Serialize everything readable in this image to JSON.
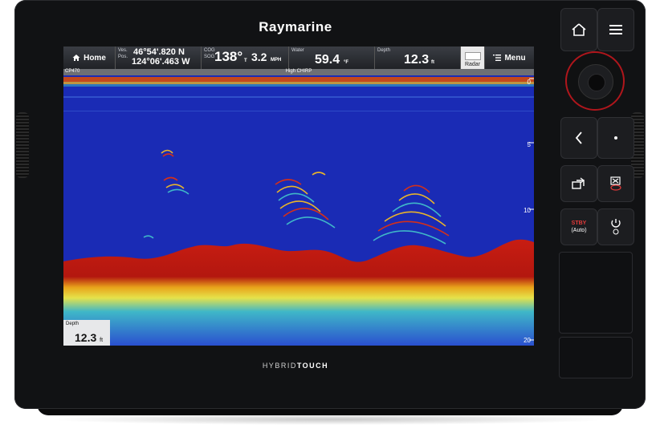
{
  "device": {
    "brand": "Raymarine",
    "footer_prefix": "HYBRID",
    "footer_suffix": "TOUCH"
  },
  "databar": {
    "home_label": "Home",
    "vessel_label_1": "Ves.",
    "vessel_label_2": "Pos.",
    "lat": "46°54'.820 N",
    "lon": "124°06'.463 W",
    "cog_label": "COG",
    "sog_label": "SOG",
    "cog_value": "138°",
    "cog_unit": "T",
    "sog_value": "3.2",
    "sog_unit": "MPH",
    "water_label": "Water",
    "water_value": "59.4",
    "water_unit": "°F",
    "depth_label": "Depth",
    "depth_value": "12.3",
    "depth_unit": "ft",
    "radar_label": "Radar",
    "menu_label": "Menu"
  },
  "status": {
    "module": "CP470",
    "channel": "High CHIRP"
  },
  "depth_scale": {
    "marks": [
      "0",
      "5",
      "10",
      "20"
    ]
  },
  "depth_box": {
    "label": "Depth",
    "value": "12.3",
    "unit": "ft"
  },
  "buttons": {
    "stby_line1": "STBY",
    "stby_line2": "(Auto)"
  },
  "colors": {
    "water": "#1a2bb5",
    "bottom": "#b81a12",
    "accent_red": "#b0161c"
  }
}
